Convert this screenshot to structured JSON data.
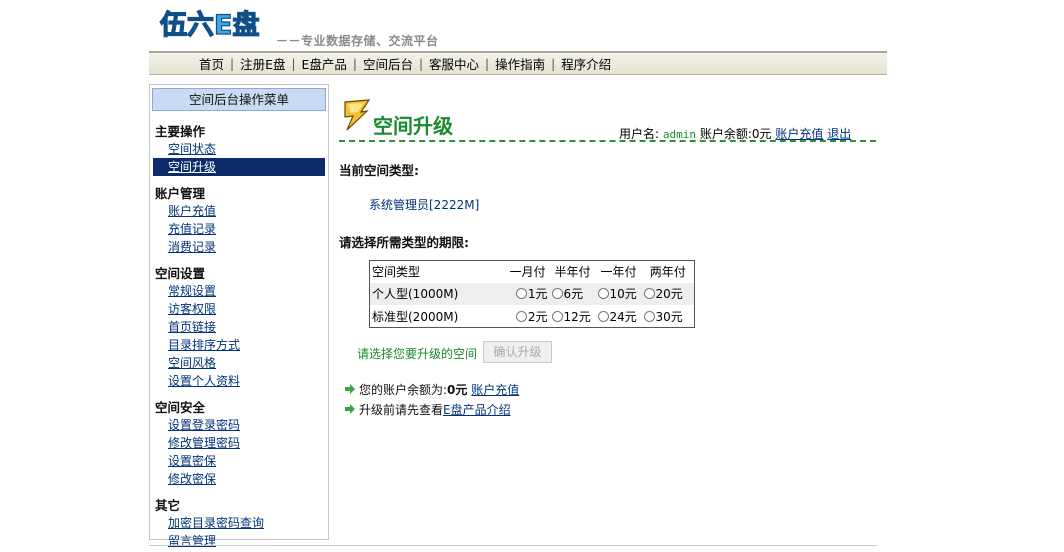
{
  "header": {
    "logo_text": "伍六E盘",
    "slogan": "－－专业数据存储、交流平台"
  },
  "nav": {
    "items": [
      "首页",
      "注册E盘",
      "E盘产品",
      "空间后台",
      "客服中心",
      "操作指南",
      "程序介绍"
    ]
  },
  "sidebar": {
    "title": "空间后台操作菜单",
    "groups": [
      {
        "title": "主要操作",
        "items": [
          "空间状态",
          "空间升级"
        ]
      },
      {
        "title": "账户管理",
        "items": [
          "账户充值",
          "充值记录",
          "消费记录"
        ]
      },
      {
        "title": "空间设置",
        "items": [
          "常规设置",
          "访客权限",
          "首页链接",
          "目录排序方式",
          "空间风格",
          "设置个人资料"
        ]
      },
      {
        "title": "空间安全",
        "items": [
          "设置登录密码",
          "修改管理密码",
          "设置密保",
          "修改密保"
        ]
      },
      {
        "title": "其它",
        "items": [
          "加密目录密码查询",
          "留言管理"
        ]
      }
    ],
    "active_item": "空间升级"
  },
  "main": {
    "title": "空间升级",
    "user_label": "用户名:",
    "username": "admin",
    "balance_label": "账户余额:",
    "balance": "0元",
    "recharge_link": "账户充值",
    "logout_link": "退出",
    "current_type_heading": "当前空间类型:",
    "current_type": "系统管理员[2222M]",
    "choose_heading": "请选择所需类型的期限:",
    "table": {
      "headers": [
        "空间类型",
        "一月付",
        "半年付",
        "一年付",
        "两年付"
      ],
      "rows": [
        {
          "type": "个人型(1000M)",
          "prices": [
            "1元",
            "6元",
            "10元",
            "20元"
          ]
        },
        {
          "type": "标准型(2000M)",
          "prices": [
            "2元",
            "12元",
            "24元",
            "30元"
          ]
        }
      ]
    },
    "select_prompt": "请选择您要升级的空间",
    "confirm_button": "确认升级",
    "info_balance_prefix": "您的账户余额为:",
    "info_balance_value": "0元",
    "info_recharge_link": "账户充值",
    "info_product_prefix": "升级前请先查看",
    "info_product_link": "E盘产品介绍"
  },
  "colors": {
    "accent_green": "#1a8a2c",
    "link_blue": "#00337a",
    "sidebar_title_bg": "#c9dbf3",
    "active_menu_bg": "#0c2b6b"
  }
}
